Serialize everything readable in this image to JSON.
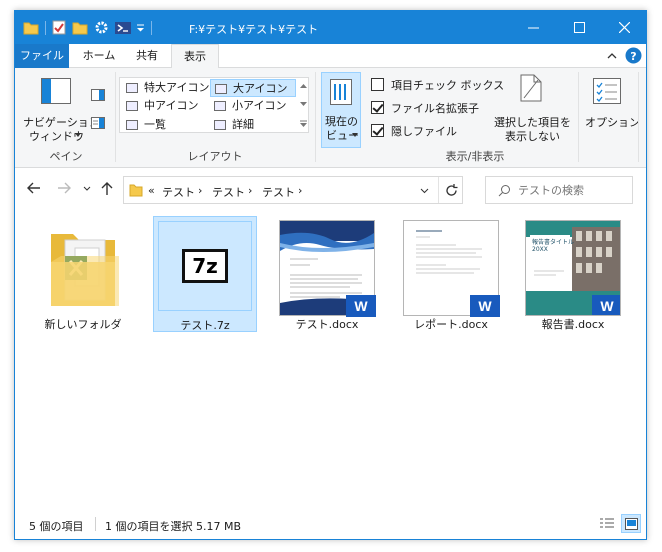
{
  "window": {
    "title": "F:¥テスト¥テスト¥テスト"
  },
  "tabs": [
    {
      "label": "ファイル"
    },
    {
      "label": "ホーム"
    },
    {
      "label": "共有"
    },
    {
      "label": "表示"
    }
  ],
  "ribbon": {
    "pane": {
      "nav_pane_line1": "ナビゲーション",
      "nav_pane_line2": "ウィンドウ",
      "group_label": "ペイン"
    },
    "layout": {
      "items": [
        "特大アイコン",
        "大アイコン",
        "中アイコン",
        "小アイコン",
        "一覧",
        "詳細"
      ],
      "group_label": "レイアウト"
    },
    "current_view": {
      "line1": "現在の",
      "line2": "ビュー"
    },
    "show_hide": {
      "checkbox_item_check": "項目チェック ボックス",
      "checkbox_extensions": "ファイル名拡張子",
      "checkbox_hidden": "隠しファイル",
      "hide_selected_line1": "選択した項目を",
      "hide_selected_line2": "表示しない",
      "group_label": "表示/非表示"
    },
    "options_label": "オプション"
  },
  "address": {
    "prefix": "«",
    "crumbs": [
      "テスト",
      "テスト",
      "テスト"
    ],
    "search_placeholder": "テストの検索"
  },
  "files": [
    {
      "name": "新しいフォルダ"
    },
    {
      "name": "テスト.7z"
    },
    {
      "name": "テスト.docx"
    },
    {
      "name": "レポート.docx"
    },
    {
      "name": "報告書.docx"
    }
  ],
  "thumb_text": {
    "sevenzip": "7z",
    "word_letter": "W",
    "report_title": "報告書タイトル",
    "report_year": "20XX"
  },
  "status": {
    "count": "5 個の項目",
    "selection": "1 個の項目を選択  5.17 MB"
  },
  "colors": {
    "titlebar": "#1883d7",
    "selection": "#cce8ff",
    "word_blue": "#185abd"
  }
}
